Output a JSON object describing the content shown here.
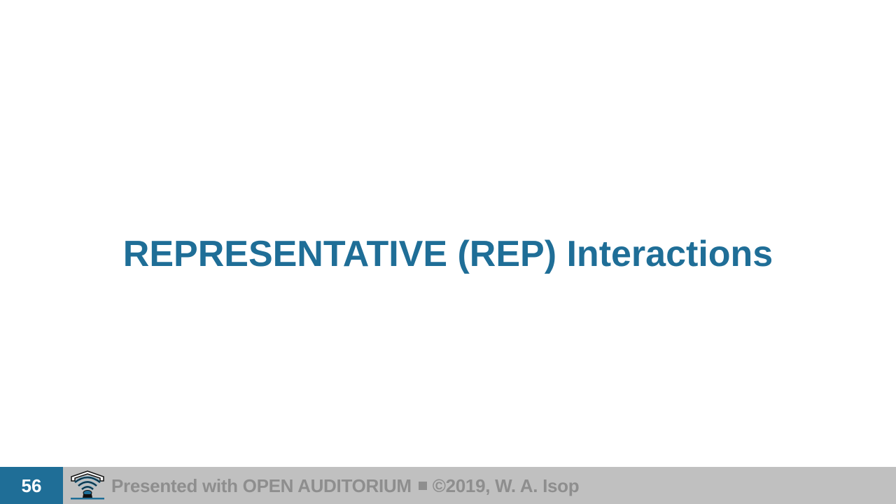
{
  "slide": {
    "title": "REPRESENTATIVE (REP) Interactions"
  },
  "footer": {
    "page_number": "56",
    "presented_with": "Presented with OPEN AUDITORIUM",
    "separator_icon": "square-bullet",
    "copyright": "©2019, W. A. Isop",
    "logo_icon": "open-auditorium-logo"
  },
  "colors": {
    "accent": "#1f6e97",
    "footer_bg": "#c0c0c0",
    "footer_text": "#8e8e8e"
  }
}
